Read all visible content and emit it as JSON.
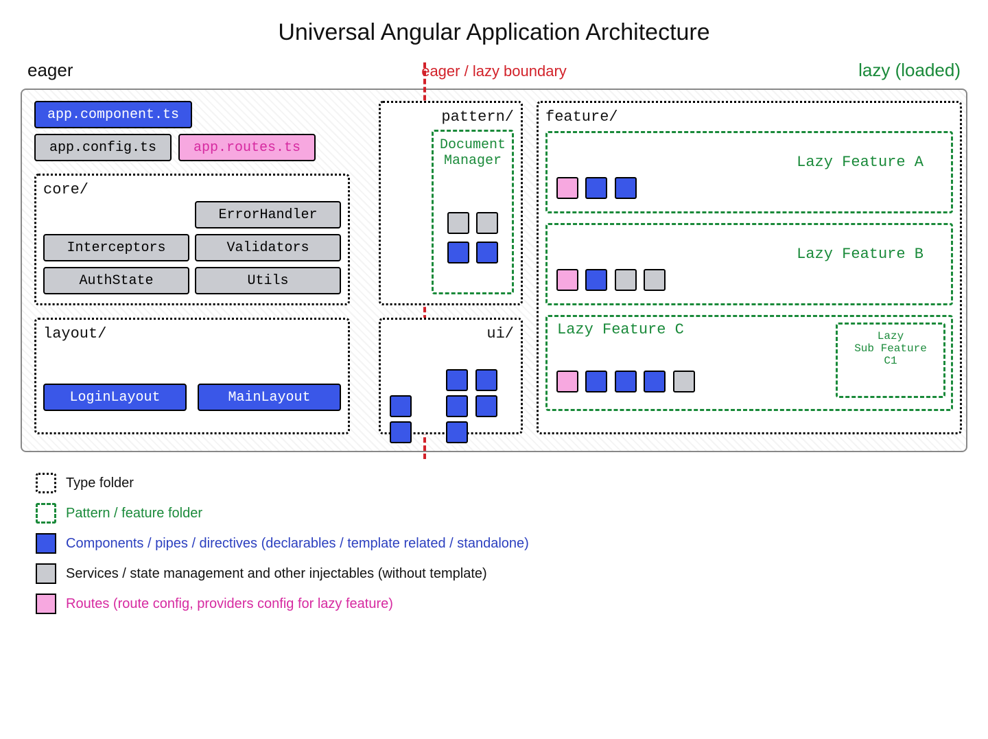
{
  "title": "Universal Angular Application Architecture",
  "labels": {
    "eager": "eager",
    "boundary": "eager / lazy boundary",
    "lazy": "lazy (loaded)"
  },
  "files": {
    "app_component": "app.component.ts",
    "app_config": "app.config.ts",
    "app_routes": "app.routes.ts"
  },
  "folders": {
    "core": "core/",
    "layout": "layout/",
    "pattern": "pattern/",
    "ui": "ui/",
    "feature": "feature/"
  },
  "core_items": {
    "error_handler": "ErrorHandler",
    "interceptors": "Interceptors",
    "validators": "Validators",
    "auth_state": "AuthState",
    "utils": "Utils"
  },
  "layout_items": {
    "login": "LoginLayout",
    "main": "MainLayout"
  },
  "pattern_items": {
    "doc_manager_1": "Document",
    "doc_manager_2": "Manager"
  },
  "features": {
    "a": "Lazy Feature A",
    "b": "Lazy Feature B",
    "c": "Lazy Feature C",
    "c1_line1": "Lazy",
    "c1_line2": "Sub Feature",
    "c1_line3": "C1"
  },
  "legend": {
    "type_folder": "Type folder",
    "feature_folder": "Pattern / feature folder",
    "components": "Components / pipes / directives (declarables / template related / standalone)",
    "services": "Services / state management and other injectables (without template)",
    "routes": "Routes (route config, providers config for lazy feature)"
  }
}
